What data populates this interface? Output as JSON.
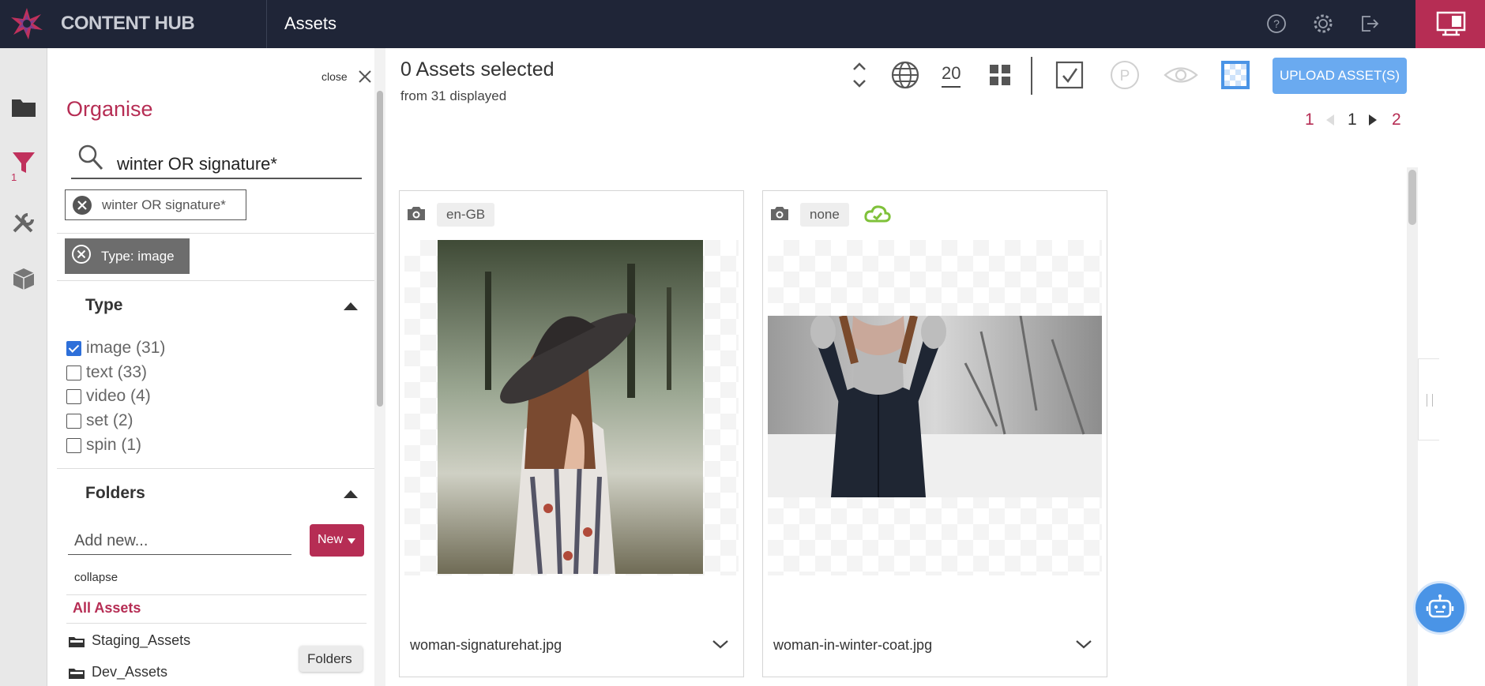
{
  "app": {
    "name": "CONTENT HUB",
    "page_title": "Assets"
  },
  "colors": {
    "accent": "#b62d54",
    "topbar": "#1f2537",
    "upload": "#6aaaf0",
    "checkbox": "#2d6fd9"
  },
  "top_icons": [
    "help-icon",
    "settings-icon",
    "logout-icon",
    "layout-toggle-icon"
  ],
  "rail": {
    "items": [
      "folder-icon",
      "filter-icon",
      "tools-icon",
      "box-icon"
    ],
    "filter_badge": "1"
  },
  "organise": {
    "close_label": "close",
    "title": "Organise",
    "search_value": "winter OR signature*",
    "active_filters": [
      "winter OR signature*",
      "Type: image"
    ],
    "type_section": {
      "title": "Type",
      "facets": [
        {
          "label": "image (31)",
          "checked": true
        },
        {
          "label": "text (33)",
          "checked": false
        },
        {
          "label": "video (4)",
          "checked": false
        },
        {
          "label": "set (2)",
          "checked": false
        },
        {
          "label": "spin (1)",
          "checked": false
        }
      ]
    },
    "folders_section": {
      "title": "Folders",
      "add_placeholder": "Add new...",
      "new_label": "New",
      "collapse_label": "collapse",
      "all_assets_label": "All Assets",
      "folders": [
        "Staging_Assets",
        "Dev_Assets"
      ],
      "tooltip": "Folders"
    }
  },
  "main": {
    "selected_label": "0 Assets selected",
    "displayed_label": "from 31 displayed",
    "page_size": "20",
    "upload_label": "UPLOAD ASSET(S)",
    "pagination": {
      "first": "1",
      "current": "1",
      "last": "2"
    },
    "cards": [
      {
        "locale": "en-GB",
        "filename": "woman-signaturehat.jpg",
        "published": false
      },
      {
        "locale": "none",
        "filename": "woman-in-winter-coat.jpg",
        "published": true
      }
    ]
  }
}
